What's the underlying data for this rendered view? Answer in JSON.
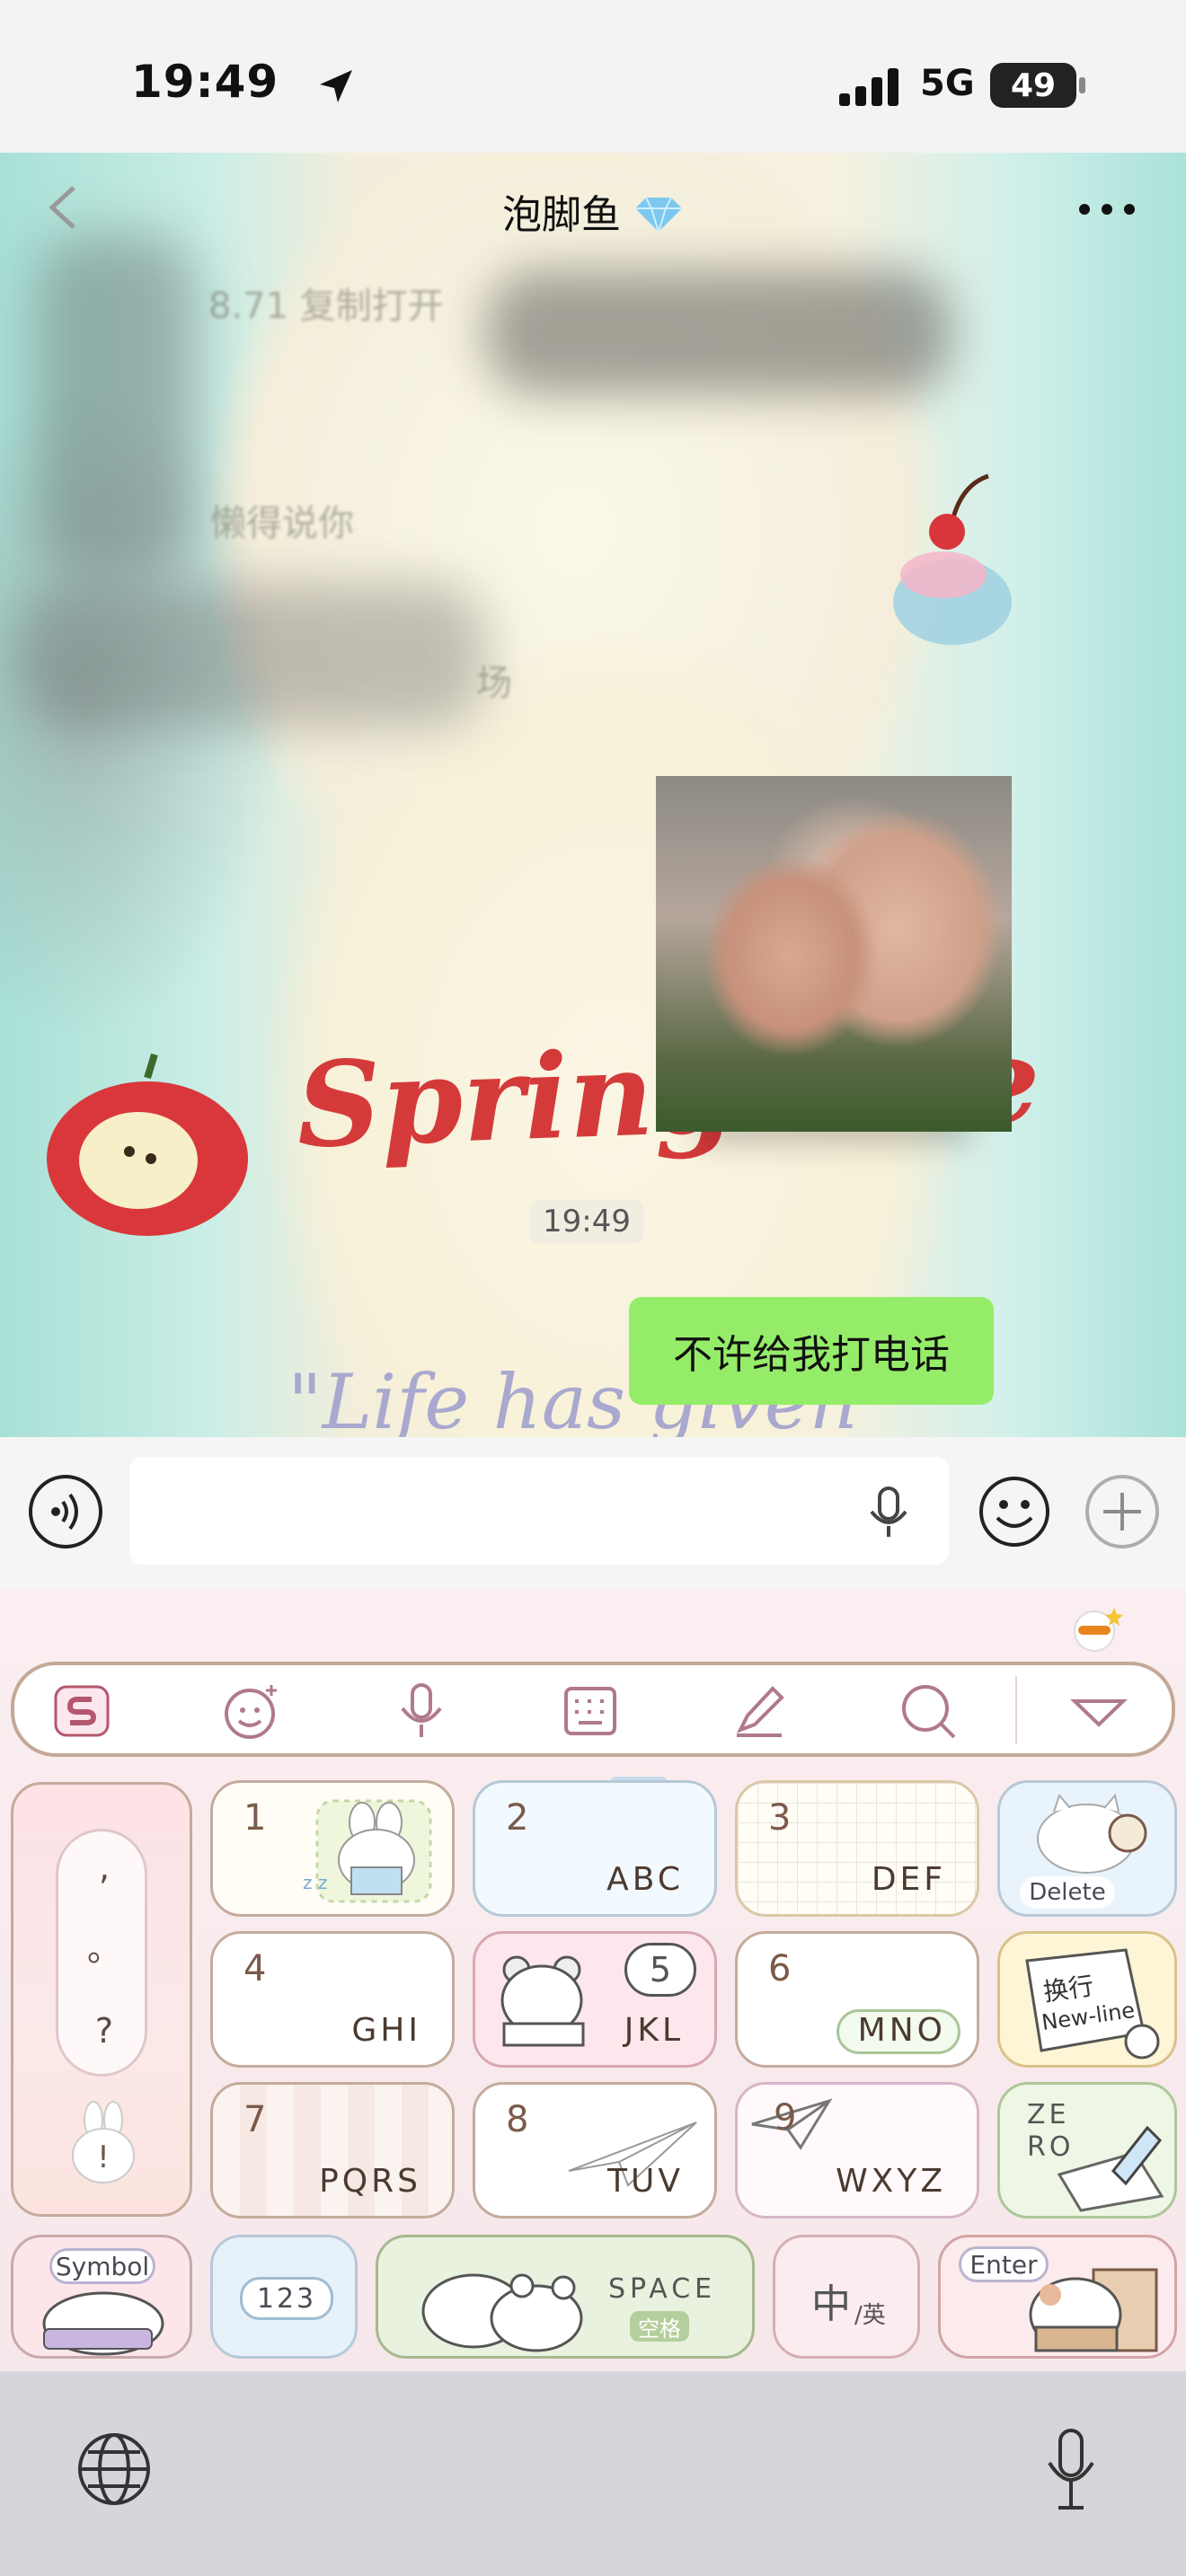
{
  "status_bar": {
    "time": "19:49",
    "network": "5G",
    "battery": "49"
  },
  "chat": {
    "title": "泡脚鱼",
    "faded_lines": [
      "8.71 复制打开",
      "懒得说你",
      "场"
    ],
    "timestamp": "19:49",
    "sent_message": "不许给我打电话",
    "background_text": {
      "spring": "Spring love",
      "quote": "\"Life has given"
    }
  },
  "keyboard": {
    "left_punct": [
      ",",
      "。",
      "?",
      "!"
    ],
    "keys": [
      {
        "num": "1",
        "letters": ""
      },
      {
        "num": "2",
        "letters": "ABC"
      },
      {
        "num": "3",
        "letters": "DEF"
      },
      {
        "num": "4",
        "letters": "GHI"
      },
      {
        "num": "5",
        "letters": "JKL"
      },
      {
        "num": "6",
        "letters": "MNO"
      },
      {
        "num": "7",
        "letters": "PQRS"
      },
      {
        "num": "8",
        "letters": "TUV"
      },
      {
        "num": "9",
        "letters": "WXYZ"
      }
    ],
    "delete_label": "Delete",
    "newline_cn": "换行",
    "newline_en": "New-line",
    "zero_label": "ZE RO",
    "symbol_label": "Symbol",
    "num_label": "123",
    "space_label": "SPACE",
    "space_cn": "空格",
    "lang_main": "中",
    "lang_sub": "/英",
    "enter_label": "Enter"
  },
  "colors": {
    "sent_bubble": "#95ec69",
    "keyboard_bg": "#fbeef0",
    "keyboard_border": "#c4ab9c"
  }
}
